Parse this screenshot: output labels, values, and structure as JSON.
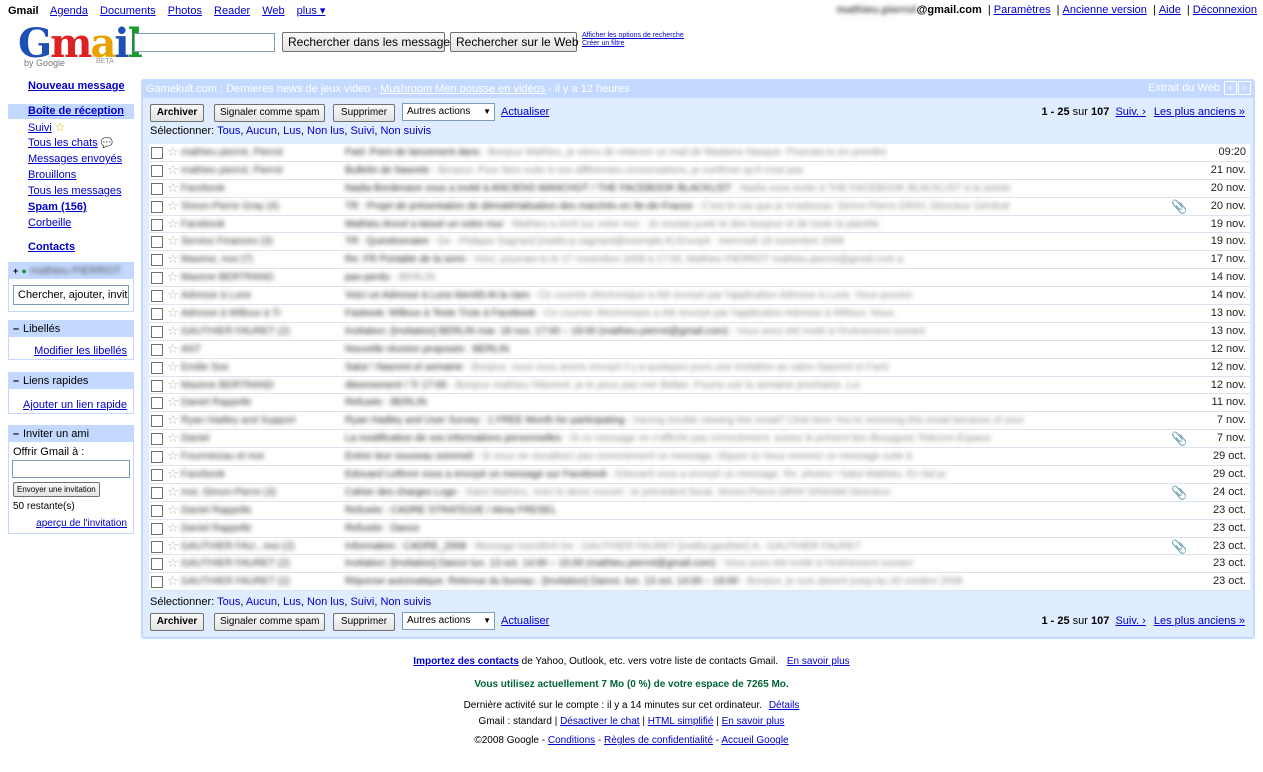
{
  "topnav": {
    "brand": "Gmail",
    "links": [
      "Agenda",
      "Documents",
      "Photos",
      "Reader",
      "Web",
      "plus ▾"
    ],
    "account_email_suffix": "@gmail.com",
    "account_email_blurred": "mathieu.pierrot",
    "right_links": [
      "Paramètres",
      "Ancienne version",
      "Aide",
      "Déconnexion"
    ]
  },
  "logo": {
    "text": "Gmail",
    "by": "by Google",
    "beta": "BETA"
  },
  "search": {
    "input_value": "",
    "btn_mail": "Rechercher dans les messages",
    "btn_web": "Rechercher sur le Web",
    "opt1": "Afficher les options de recherche",
    "opt2": "Créer un filtre"
  },
  "nav": {
    "compose": "Nouveau message",
    "inbox": "Boîte de réception",
    "items": [
      "Suivi",
      "Tous les chats",
      "Messages envoyés",
      "Brouillons",
      "Tous les messages",
      "Spam (156)",
      "Corbeille"
    ],
    "contacts": "Contacts",
    "chat_user": "mathieu PIERROT",
    "chat_search_placeholder": "Chercher, ajouter, inviter",
    "labels_title": "Libellés",
    "labels_link": "Modifier les libellés",
    "quick_title": "Liens rapides",
    "quick_link": "Ajouter un lien rapide",
    "invite_title": "Inviter un ami",
    "invite_offer": "Offrir Gmail à :",
    "invite_value": "",
    "invite_button": "Envoyer une invitation",
    "invite_left": "50 restante(s)",
    "invite_preview": "aperçu de l'invitation"
  },
  "webclip": {
    "prefix": "Gamekult.com : Dernieres news de jeux video - ",
    "link": "Mushroom Men pousse en vidéos",
    "suffix": " - il y a 12 heures",
    "label": "Extrait du Web",
    "prev": "<",
    "next": ">"
  },
  "toolbar": {
    "archive": "Archiver",
    "spam": "Signaler comme spam",
    "delete": "Supprimer",
    "more_actions": "Autres actions",
    "refresh": "Actualiser",
    "range": "1 - 25",
    "of": " sur ",
    "total": "107",
    "next": "Suiv. ›",
    "oldest": "Les plus anciens »"
  },
  "select_row": {
    "label": "Sélectionner:",
    "options": [
      "Tous",
      "Aucun",
      "Lus",
      "Non lus",
      "Suivi",
      "Non suivis"
    ]
  },
  "messages": [
    {
      "sender": "mathieu pierrot, Pierrot",
      "subject": "Fwd: Point de lancement dans",
      "snippet": "Bonjour Mathieu, je viens de relancer ce mail de Madame Nasque. Pourrais-tu en prendre",
      "date": "09:20",
      "attachment": false
    },
    {
      "sender": "mathieu pierrot, Pierrot",
      "subject": "Bulletin de Nasrete",
      "snippet": "Bonjour, Pour faire suite à nos différentes conversations, je confirme qu'il n'est pas",
      "date": "21 nov.",
      "attachment": false
    },
    {
      "sender": "Facebook",
      "subject": "Nadia Bordenave vous a invité à ANCIENS MANCHOT / THE FACEBOOK BLACKLIST",
      "snippet": "Nadia vous invite à THE FACEBOOK BLACKLIST à la soirée",
      "date": "20 nov.",
      "attachment": false
    },
    {
      "sender": "Simon-Pierre Gray (4)",
      "subject": "TR : Projet de présentation de dématérialisation des marchés en Ile-de-France",
      "snippet": "C'est le cas que je m'adresse: Simon-Pierre GRAY, Directeur Général",
      "date": "20 nov.",
      "attachment": true
    },
    {
      "sender": "Facebook",
      "subject": "Mathieu Ancel a laissé un votre mur",
      "snippet": "Mathieu a écrit sur votre mur : Je voulais juste te dire bonjour et de toute la planète",
      "date": "19 nov.",
      "attachment": false
    },
    {
      "sender": "Service Finances (3)",
      "subject": "TR : Questionnaire",
      "snippet": "De : Philippe Sagnard [mailto:p.sagnard@exemple.fr] Envoyé : mercredi 19 novembre 2008",
      "date": "19 nov.",
      "attachment": false
    },
    {
      "sender": "Maxime, moi (7)",
      "subject": "Re: FR Portable de la semi",
      "snippet": "Voici, pourrais-tu le 17 novembre 2008 à 17:00, Mathieu PIERROT mathieu.pierrot@gmail.com a",
      "date": "17 nov.",
      "attachment": false
    },
    {
      "sender": "Maxime BERTRAND",
      "subject": "pas-perdu",
      "snippet": "BERLIN",
      "date": "14 nov.",
      "attachment": false
    },
    {
      "sender": "Adresse à Lune",
      "subject": "Voici un Adresse à Lune bientôt At la riam",
      "snippet": "Ce courrier électronique a été envoyé par l'application Adresse à Lune. Vous pouvez",
      "date": "14 nov.",
      "attachment": false
    },
    {
      "sender": "Adresse à Willoux à Tr",
      "subject": "Fasbook: Willoux à Texte Trois à Facebook",
      "snippet": "Ce courrier électronique a été envoyé par l'application Adresse à Willoux. Nous",
      "date": "13 nov.",
      "attachment": false
    },
    {
      "sender": "GAUTHIER FAURET (2)",
      "subject": "Invitation: [Invitation] BERLIN mar. 18 nov. 17:00 – 19:00 (mathieu.pierrot@gmail.com)",
      "snippet": "Vous avez été invité à l'événement suivant",
      "date": "13 nov.",
      "attachment": false
    },
    {
      "sender": "ANT",
      "subject": "Nouvelle réunion proposée : BERLIN",
      "snippet": "",
      "date": "12 nov.",
      "attachment": false
    },
    {
      "sender": "Emilie Soe",
      "subject": "Salut ! Nasrent et semaine",
      "snippet": "Bonjour, nous vous avons envoyé il y a quelques jours une invitation au salon Nasrent et Fami",
      "date": "12 nov.",
      "attachment": false
    },
    {
      "sender": "Maxime BERTRAND",
      "subject": "Abonnement / Tr 17:00",
      "snippet": "Bonjour mathieu l'Abonné, je te peux pas mer Bellan. Pourra voir la semaine prochaine. Lui",
      "date": "12 nov.",
      "attachment": false
    },
    {
      "sender": "Daniel Rappelle",
      "subject": "Refusée : BERLIN",
      "snippet": "",
      "date": "11 nov.",
      "attachment": false
    },
    {
      "sender": "Ryan Hadley and Support",
      "subject": "Ryan Hadley and User Survey : 1 FREE Month for participating",
      "snippet": "Having trouble viewing this email? Click here You're receiving this email because of your",
      "date": "7 nov.",
      "attachment": false
    },
    {
      "sender": "Daniel",
      "subject": "La modification de vos informations personnelles",
      "snippet": "Si ce message ne s'affiche pas correctement, suivez le présent lien Bouygues Telecom Espace",
      "date": "7 nov.",
      "attachment": true
    },
    {
      "sender": "Fourmiezau et moi",
      "subject": "Entrer leur nouveau sommeil",
      "snippet": "Si vous ne visualisez pas correctement ce message, cliquez ici Vous recevez ce message suite à",
      "date": "29 oct.",
      "attachment": false
    },
    {
      "sender": "Facebook",
      "subject": "Edouard Lefèvre vous a envoyé un message sur Facebook",
      "snippet": "Edouard vous a envoyé un message. Re: photos ! Salut Mathieu, En fait je",
      "date": "29 oct.",
      "attachment": false
    },
    {
      "sender": "moi, Simon-Pierre (3)",
      "subject": "Cahier des charges Logo",
      "snippet": "Salut Mathieu, Voici le devis nouvel - le précédent fiscal. Simon-Pierre GRAY ERASMI Directeur",
      "date": "24 oct.",
      "attachment": true
    },
    {
      "sender": "Daniel Rappelle",
      "subject": "Refusée : CADRE STRATÉGIE / Alma FRESEL",
      "snippet": "",
      "date": "23 oct.",
      "attachment": false
    },
    {
      "sender": "Daniel Rappelle",
      "subject": "Refusée : Dance",
      "snippet": "",
      "date": "23 oct.",
      "attachment": false
    },
    {
      "sender": "GAUTHIER FAU., moi (2)",
      "subject": "Information : CADRE_2008",
      "snippet": "Message transféré De : GAUTHIER FAURET [mailto:gauthier] À : GAUTHIER FAURET",
      "date": "23 oct.",
      "attachment": true
    },
    {
      "sender": "GAUTHIER FAURET (2)",
      "subject": "Invitation: [Invitation] Dance lun. 13 oct. 14:00 – 15:00 (mathieu.pierrot@gmail.com)",
      "snippet": "Vous avez été invité à l'événement suivant",
      "date": "23 oct.",
      "attachment": false
    },
    {
      "sender": "GAUTHIER FAURET (2)",
      "subject": "Réponse automatique: Retenue du bureau : [Invitation] Dance, lun. 13 oct. 14:00 – 19:00",
      "snippet": "Bonjour, je suis absent jusqu'au 20 octobre 2008",
      "date": "23 oct.",
      "attachment": false
    }
  ],
  "footer": {
    "import_link": "Importez des contacts",
    "import_text": " de Yahoo, Outlook, etc. vers votre liste de contacts Gmail.",
    "import_more": "En savoir plus",
    "storage": "Vous utilisez actuellement 7 Mo (0 %) de votre espace de 7265 Mo.",
    "activity": "Dernière activité sur le compte : il y a 14 minutes sur cet ordinateur.",
    "activity_link": "Détails",
    "view_prefix": "Gmail : standard | ",
    "view_links": [
      "Désactiver le chat",
      "HTML simplifié",
      "En savoir plus"
    ],
    "copyright": "©2008 Google - ",
    "copy_links": [
      "Conditions",
      "Règles de confidentialité",
      "Accueil Google"
    ]
  },
  "colors": {
    "accent": "#c3d9ff",
    "panel": "#e0ecff",
    "link": "#0000cc",
    "storage": "#006633"
  }
}
